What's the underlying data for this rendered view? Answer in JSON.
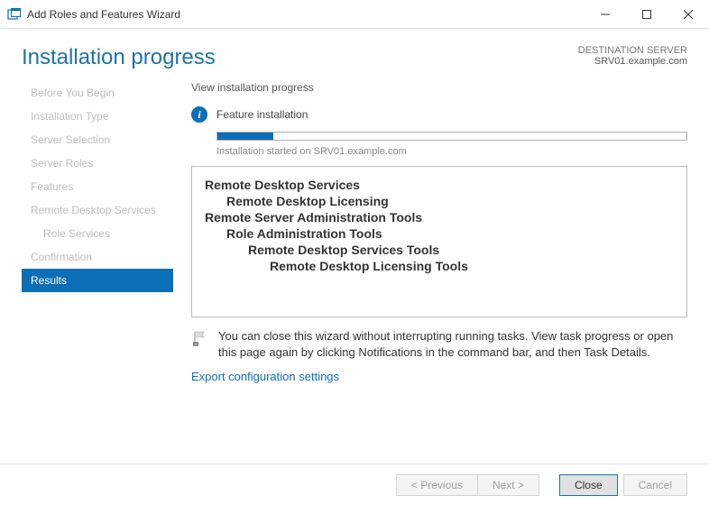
{
  "window": {
    "title": "Add Roles and Features Wizard"
  },
  "header": {
    "title": "Installation progress",
    "destination_label": "DESTINATION SERVER",
    "destination_value": "SRV01.example.com"
  },
  "sidebar": {
    "steps": [
      "Before You Begin",
      "Installation Type",
      "Server Selection",
      "Server Roles",
      "Features",
      "Remote Desktop Services",
      "Role Services",
      "Confirmation",
      "Results"
    ]
  },
  "content": {
    "view_label": "View installation progress",
    "status_text": "Feature installation",
    "sub_status": "Installation started on SRV01.example.com",
    "progress_percent": 12,
    "tree": {
      "l0a": "Remote Desktop Services",
      "l1a": "Remote Desktop Licensing",
      "l0b": "Remote Server Administration Tools",
      "l1b": "Role Administration Tools",
      "l2b": "Remote Desktop Services Tools",
      "l3b": "Remote Desktop Licensing Tools"
    },
    "hint": "You can close this wizard without interrupting running tasks. View task progress or open this page again by clicking Notifications in the command bar, and then Task Details.",
    "export_link": "Export configuration settings"
  },
  "footer": {
    "previous": "< Previous",
    "next": "Next >",
    "close": "Close",
    "cancel": "Cancel"
  }
}
